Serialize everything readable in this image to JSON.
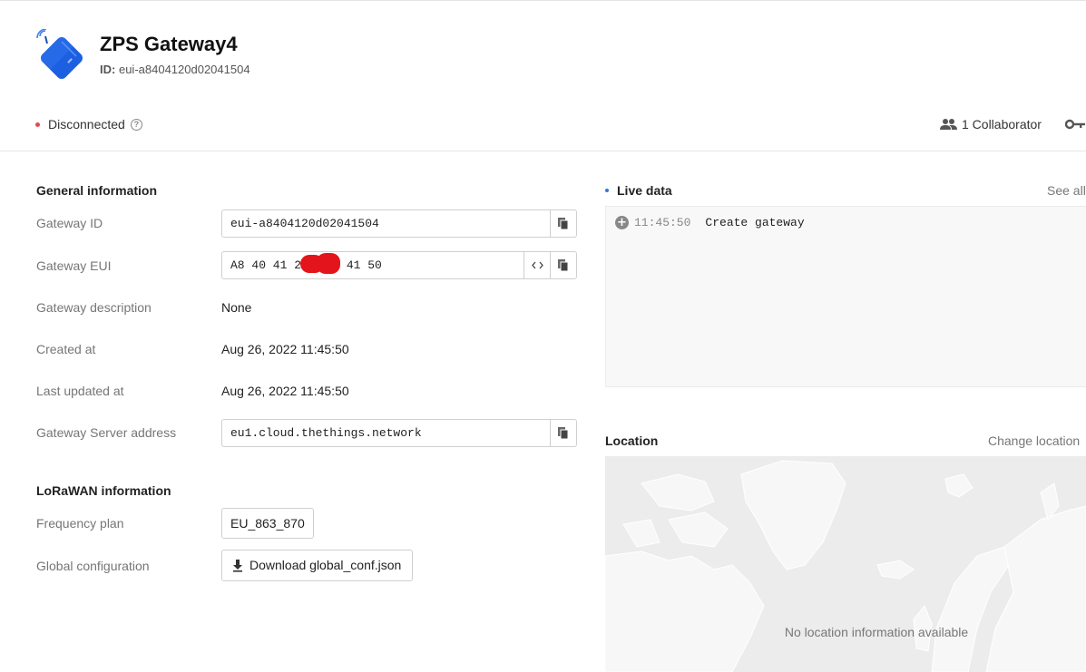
{
  "header": {
    "title": "ZPS Gateway4",
    "id_label": "ID:",
    "id_value": "eui-a8404120d02041504",
    "status": "Disconnected",
    "collaborators": "1 Collaborator"
  },
  "general": {
    "section_title": "General information",
    "gateway_id_label": "Gateway ID",
    "gateway_id": "eui-a8404120d02041504",
    "gateway_eui_label": "Gateway EUI",
    "gateway_eui_prefix": "A8 40 41 20",
    "gateway_eui_suffix": "41 50",
    "description_label": "Gateway description",
    "description": "None",
    "created_label": "Created at",
    "created": "Aug 26, 2022 11:45:50",
    "updated_label": "Last updated at",
    "updated": "Aug 26, 2022 11:45:50",
    "server_label": "Gateway Server address",
    "server": "eu1.cloud.thethings.network"
  },
  "lorawan": {
    "section_title": "LoRaWAN information",
    "frequency_label": "Frequency plan",
    "frequency": "EU_863_870",
    "global_config_label": "Global configuration",
    "download_label": "Download global_conf.json"
  },
  "live_data": {
    "title": "Live data",
    "see_all": "See all",
    "events": [
      {
        "time": "11:45:50",
        "message": "Create gateway"
      }
    ]
  },
  "location": {
    "title": "Location",
    "change": "Change location",
    "empty": "No location information available"
  },
  "colors": {
    "status_disconnected": "#e5484d",
    "live_dot": "#2e7bd6",
    "logo_blue": "#1c5fe0",
    "redaction": "#e3141b"
  },
  "icons": {
    "logo": "gateway-icon",
    "status": "help-icon",
    "collaborators": "people-icon",
    "api_keys": "key-icon",
    "copy": "copy-icon",
    "toggle_format": "code-icon",
    "download": "download-icon",
    "event": "plus-circle-icon"
  }
}
